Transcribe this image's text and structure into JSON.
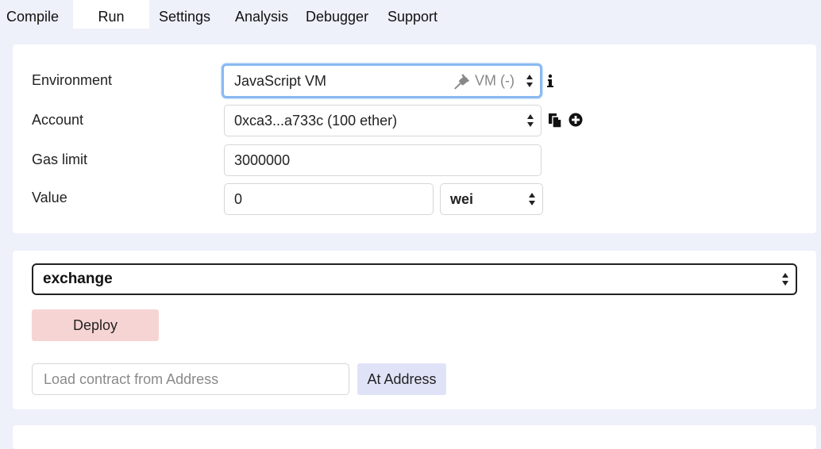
{
  "tabs": {
    "compile": "Compile",
    "run": "Run",
    "settings": "Settings",
    "analysis": "Analysis",
    "debugger": "Debugger",
    "support": "Support",
    "active": "run"
  },
  "settings": {
    "environment": {
      "label": "Environment",
      "value": "JavaScript VM",
      "vm_status": "VM (-)",
      "status_icon": "plug-icon",
      "info_icon": "info-icon"
    },
    "account": {
      "label": "Account",
      "value": "0xca3...a733c (100 ether)",
      "copy_icon": "copy-icon",
      "add_icon": "plus-circle-icon"
    },
    "gas_limit": {
      "label": "Gas limit",
      "value": "3000000"
    },
    "value": {
      "label": "Value",
      "amount": "0",
      "unit": "wei"
    }
  },
  "contract": {
    "selected": "exchange",
    "deploy_label": "Deploy",
    "address_placeholder": "Load contract from Address",
    "at_address_label": "At Address"
  },
  "colors": {
    "background": "#eef0fa",
    "panel": "#ffffff",
    "focus_ring": "#8ab9f1",
    "deploy": "#f7d4d4",
    "at_address": "#e0e3f8"
  }
}
